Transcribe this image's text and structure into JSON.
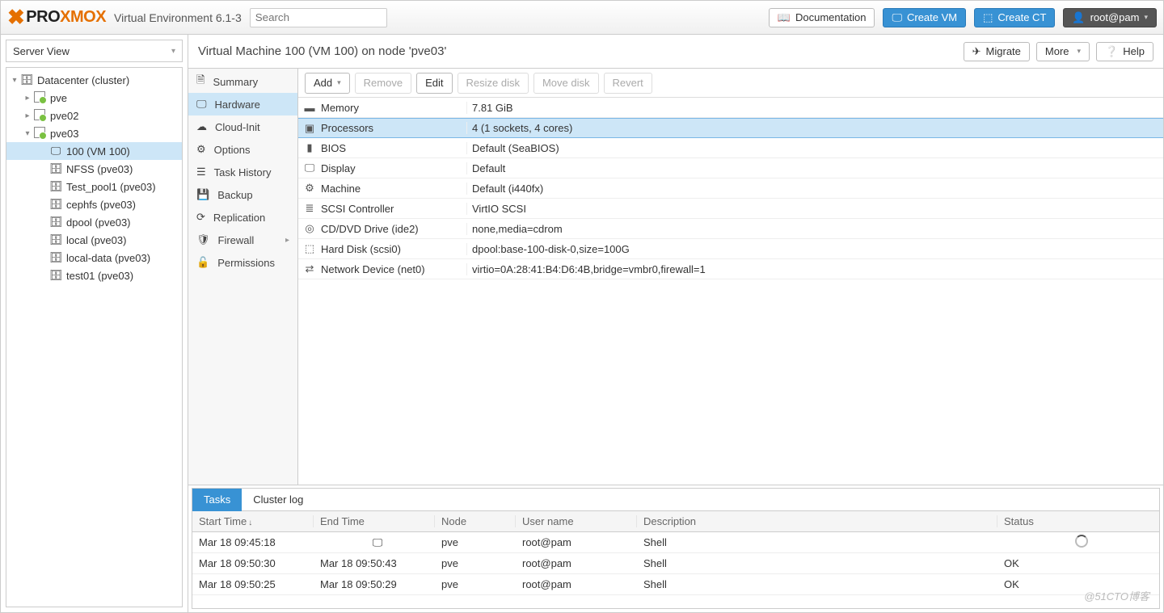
{
  "header": {
    "brand_pro": "PRO",
    "brand_xmo": "XMOX",
    "version": "Virtual Environment 6.1-3",
    "search_placeholder": "Search",
    "documentation": "Documentation",
    "create_vm": "Create VM",
    "create_ct": "Create CT",
    "user": "root@pam"
  },
  "view_selector": "Server View",
  "tree": {
    "datacenter": "Datacenter (cluster)",
    "nodes": [
      "pve",
      "pve02",
      "pve03"
    ],
    "vm": "100 (VM 100)",
    "storages": [
      "NFSS (pve03)",
      "Test_pool1 (pve03)",
      "cephfs (pve03)",
      "dpool (pve03)",
      "local (pve03)",
      "local-data (pve03)",
      "test01 (pve03)"
    ]
  },
  "vm_header": {
    "title": "Virtual Machine 100 (VM 100) on node 'pve03'",
    "migrate": "Migrate",
    "more": "More",
    "help": "Help"
  },
  "sidemenu": {
    "items": [
      "Summary",
      "Hardware",
      "Cloud-Init",
      "Options",
      "Task History",
      "Backup",
      "Replication",
      "Firewall",
      "Permissions"
    ]
  },
  "toolbar": {
    "add": "Add",
    "remove": "Remove",
    "edit": "Edit",
    "resize": "Resize disk",
    "move": "Move disk",
    "revert": "Revert"
  },
  "hw_rows": [
    {
      "key": "Memory",
      "val": "7.81 GiB",
      "icon": "▬"
    },
    {
      "key": "Processors",
      "val": "4 (1 sockets, 4 cores)",
      "icon": "▣",
      "selected": true
    },
    {
      "key": "BIOS",
      "val": "Default (SeaBIOS)",
      "icon": "▮"
    },
    {
      "key": "Display",
      "val": "Default",
      "icon": "🖵"
    },
    {
      "key": "Machine",
      "val": "Default (i440fx)",
      "icon": "⚙"
    },
    {
      "key": "SCSI Controller",
      "val": "VirtIO SCSI",
      "icon": "≣"
    },
    {
      "key": "CD/DVD Drive (ide2)",
      "val": "none,media=cdrom",
      "icon": "◎"
    },
    {
      "key": "Hard Disk (scsi0)",
      "val": "dpool:base-100-disk-0,size=100G",
      "icon": "⬚"
    },
    {
      "key": "Network Device (net0)",
      "val": "virtio=0A:28:41:B4:D6:4B,bridge=vmbr0,firewall=1",
      "icon": "⇄"
    }
  ],
  "bottom": {
    "tabs": [
      "Tasks",
      "Cluster log"
    ],
    "columns": {
      "start": "Start Time",
      "end": "End Time",
      "node": "Node",
      "user": "User name",
      "desc": "Description",
      "status": "Status"
    },
    "rows": [
      {
        "start": "Mar 18 09:45:18",
        "end": "",
        "node": "pve",
        "user": "root@pam",
        "desc": "Shell",
        "status": "",
        "running": true
      },
      {
        "start": "Mar 18 09:50:30",
        "end": "Mar 18 09:50:43",
        "node": "pve",
        "user": "root@pam",
        "desc": "Shell",
        "status": "OK"
      },
      {
        "start": "Mar 18 09:50:25",
        "end": "Mar 18 09:50:29",
        "node": "pve",
        "user": "root@pam",
        "desc": "Shell",
        "status": "OK"
      }
    ]
  },
  "watermark": "@51CTO博客"
}
